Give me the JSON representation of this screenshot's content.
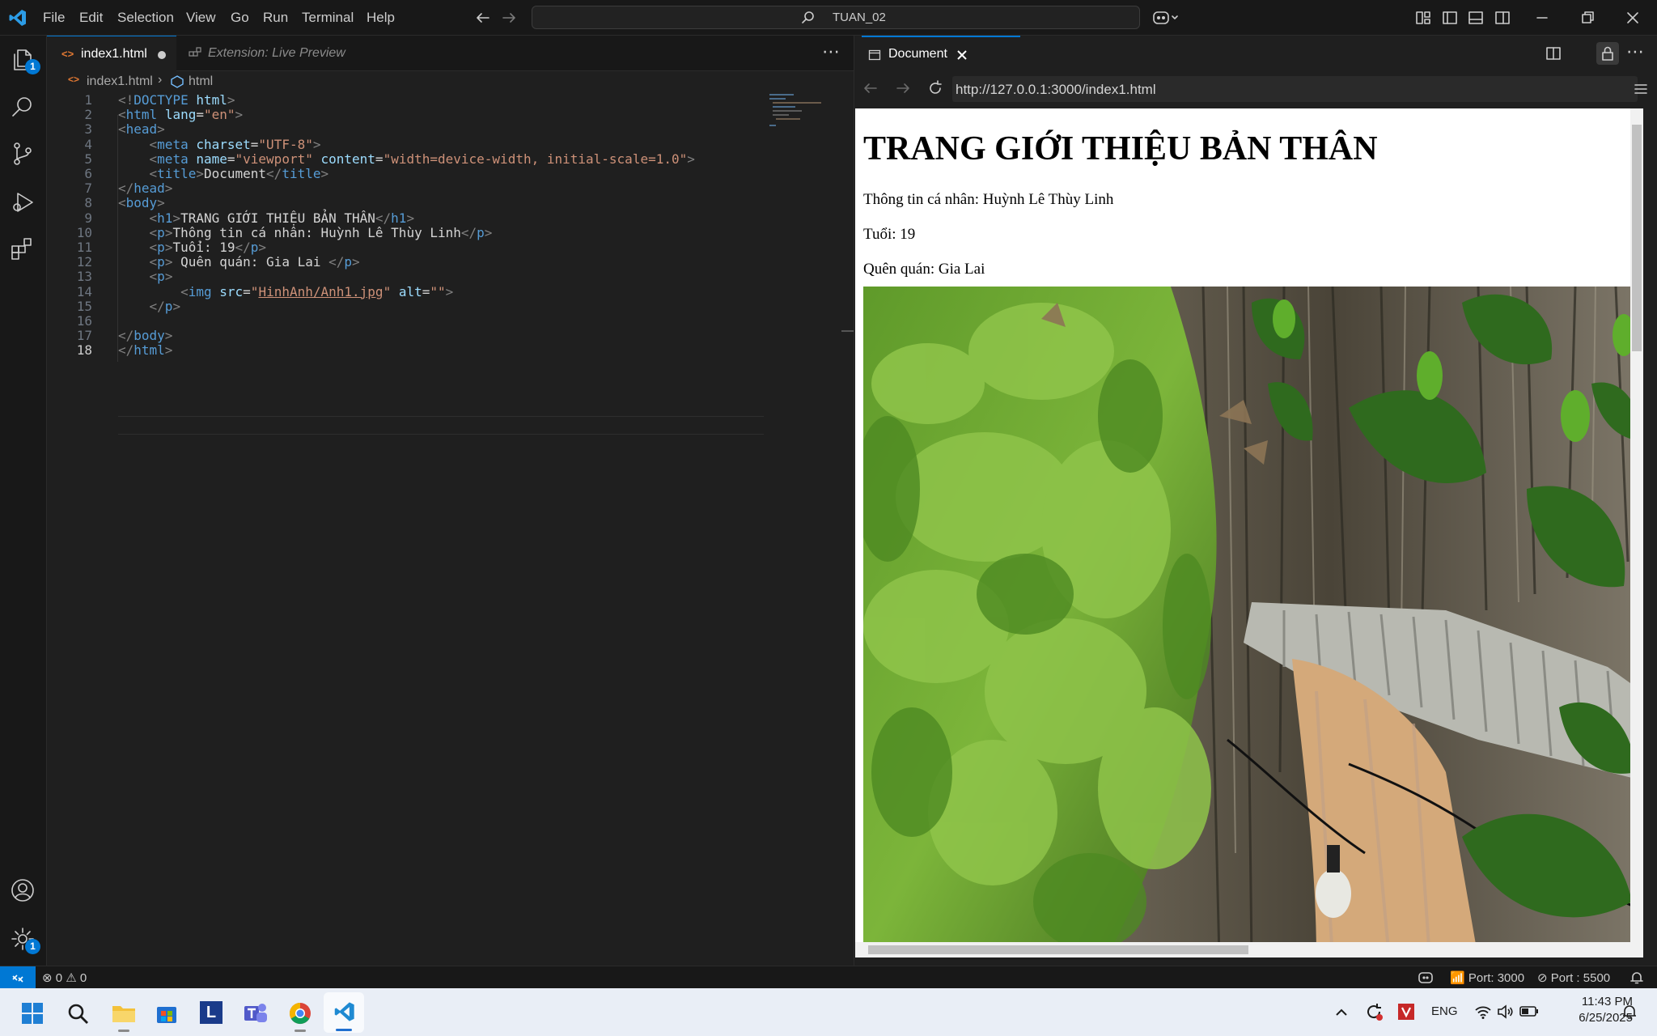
{
  "titlebar": {
    "menus": [
      "File",
      "Edit",
      "Selection",
      "View",
      "Go",
      "Run",
      "Terminal",
      "Help"
    ],
    "search_text": "TUAN_02"
  },
  "activity": {
    "explorer_badge": "1",
    "settings_badge": "1"
  },
  "editor": {
    "tabs": [
      {
        "label": "index1.html",
        "modified": true
      },
      {
        "label": "Extension: Live Preview"
      }
    ],
    "breadcrumb": {
      "file": "index1.html",
      "symbol": "html"
    },
    "line_numbers": [
      "1",
      "2",
      "3",
      "4",
      "5",
      "6",
      "7",
      "8",
      "9",
      "10",
      "11",
      "12",
      "13",
      "14",
      "15",
      "16",
      "17",
      "18"
    ],
    "code": [
      [
        [
          "br",
          "<!"
        ],
        [
          "tg",
          "DOCTYPE"
        ],
        [
          "tx",
          " "
        ],
        [
          "at",
          "html"
        ],
        [
          "br",
          ">"
        ]
      ],
      [
        [
          "br",
          "<"
        ],
        [
          "tg",
          "html"
        ],
        [
          "tx",
          " "
        ],
        [
          "at",
          "lang"
        ],
        [
          "tx",
          "="
        ],
        [
          "st",
          "\"en\""
        ],
        [
          "br",
          ">"
        ]
      ],
      [
        [
          "br",
          "<"
        ],
        [
          "tg",
          "head"
        ],
        [
          "br",
          ">"
        ]
      ],
      [
        [
          "tx",
          "    "
        ],
        [
          "br",
          "<"
        ],
        [
          "tg",
          "meta"
        ],
        [
          "tx",
          " "
        ],
        [
          "at",
          "charset"
        ],
        [
          "tx",
          "="
        ],
        [
          "st",
          "\"UTF-8\""
        ],
        [
          "br",
          ">"
        ]
      ],
      [
        [
          "tx",
          "    "
        ],
        [
          "br",
          "<"
        ],
        [
          "tg",
          "meta"
        ],
        [
          "tx",
          " "
        ],
        [
          "at",
          "name"
        ],
        [
          "tx",
          "="
        ],
        [
          "st",
          "\"viewport\""
        ],
        [
          "tx",
          " "
        ],
        [
          "at",
          "content"
        ],
        [
          "tx",
          "="
        ],
        [
          "st",
          "\"width=device-width, initial-scale=1.0\""
        ],
        [
          "br",
          ">"
        ]
      ],
      [
        [
          "tx",
          "    "
        ],
        [
          "br",
          "<"
        ],
        [
          "tg",
          "title"
        ],
        [
          "br",
          ">"
        ],
        [
          "tx",
          "Document"
        ],
        [
          "br",
          "</"
        ],
        [
          "tg",
          "title"
        ],
        [
          "br",
          ">"
        ]
      ],
      [
        [
          "br",
          "</"
        ],
        [
          "tg",
          "head"
        ],
        [
          "br",
          ">"
        ]
      ],
      [
        [
          "br",
          "<"
        ],
        [
          "tg",
          "body"
        ],
        [
          "br",
          ">"
        ]
      ],
      [
        [
          "tx",
          "    "
        ],
        [
          "br",
          "<"
        ],
        [
          "tg",
          "h1"
        ],
        [
          "br",
          ">"
        ],
        [
          "tx",
          "TRANG GIỚI THIỆU BẢN THÂN"
        ],
        [
          "br",
          "</"
        ],
        [
          "tg",
          "h1"
        ],
        [
          "br",
          ">"
        ]
      ],
      [
        [
          "tx",
          "    "
        ],
        [
          "br",
          "<"
        ],
        [
          "tg",
          "p"
        ],
        [
          "br",
          ">"
        ],
        [
          "tx",
          "Thông tin cá nhân: Huỳnh Lê Thùy Linh"
        ],
        [
          "br",
          "</"
        ],
        [
          "tg",
          "p"
        ],
        [
          "br",
          ">"
        ]
      ],
      [
        [
          "tx",
          "    "
        ],
        [
          "br",
          "<"
        ],
        [
          "tg",
          "p"
        ],
        [
          "br",
          ">"
        ],
        [
          "tx",
          "Tuổi: 19"
        ],
        [
          "br",
          "</"
        ],
        [
          "tg",
          "p"
        ],
        [
          "br",
          ">"
        ]
      ],
      [
        [
          "tx",
          "    "
        ],
        [
          "br",
          "<"
        ],
        [
          "tg",
          "p"
        ],
        [
          "br",
          ">"
        ],
        [
          "tx",
          " Quên quán: Gia Lai "
        ],
        [
          "br",
          "</"
        ],
        [
          "tg",
          "p"
        ],
        [
          "br",
          ">"
        ]
      ],
      [
        [
          "tx",
          "    "
        ],
        [
          "br",
          "<"
        ],
        [
          "tg",
          "p"
        ],
        [
          "br",
          ">"
        ]
      ],
      [
        [
          "tx",
          "        "
        ],
        [
          "br",
          "<"
        ],
        [
          "tg",
          "img"
        ],
        [
          "tx",
          " "
        ],
        [
          "at",
          "src"
        ],
        [
          "tx",
          "="
        ],
        [
          "st",
          "\""
        ],
        [
          "stu",
          "HinhAnh/Anh1.jpg"
        ],
        [
          "st",
          "\""
        ],
        [
          "tx",
          " "
        ],
        [
          "at",
          "alt"
        ],
        [
          "tx",
          "="
        ],
        [
          "st",
          "\"\""
        ],
        [
          "br",
          ">"
        ]
      ],
      [
        [
          "tx",
          "    "
        ],
        [
          "br",
          "</"
        ],
        [
          "tg",
          "p"
        ],
        [
          "br",
          ">"
        ]
      ],
      [],
      [
        [
          "br",
          "</"
        ],
        [
          "tg",
          "body"
        ],
        [
          "br",
          ">"
        ]
      ],
      [
        [
          "br",
          "</"
        ],
        [
          "tg",
          "html"
        ],
        [
          "br",
          ">"
        ]
      ]
    ]
  },
  "preview": {
    "tab_label": "Document",
    "url": "http://127.0.0.1:3000/index1.html",
    "page": {
      "heading": "TRANG GIỚI THIỆU BẢN THÂN",
      "info": "Thông tin cá nhân: Huỳnh Lê Thùy Linh",
      "age": "Tuổi: 19",
      "hometown": "Quên quán: Gia Lai"
    }
  },
  "status": {
    "errors": "0",
    "warnings": "0",
    "port_live": "Port: 3000",
    "port_server": "Port : 5500"
  },
  "taskbar": {
    "language": "ENG",
    "time": "11:43 PM",
    "date": "6/25/2025"
  },
  "colors": {
    "accent": "#0078d4",
    "editor_bg": "#1f1f1f",
    "chrome_bg": "#181818"
  }
}
